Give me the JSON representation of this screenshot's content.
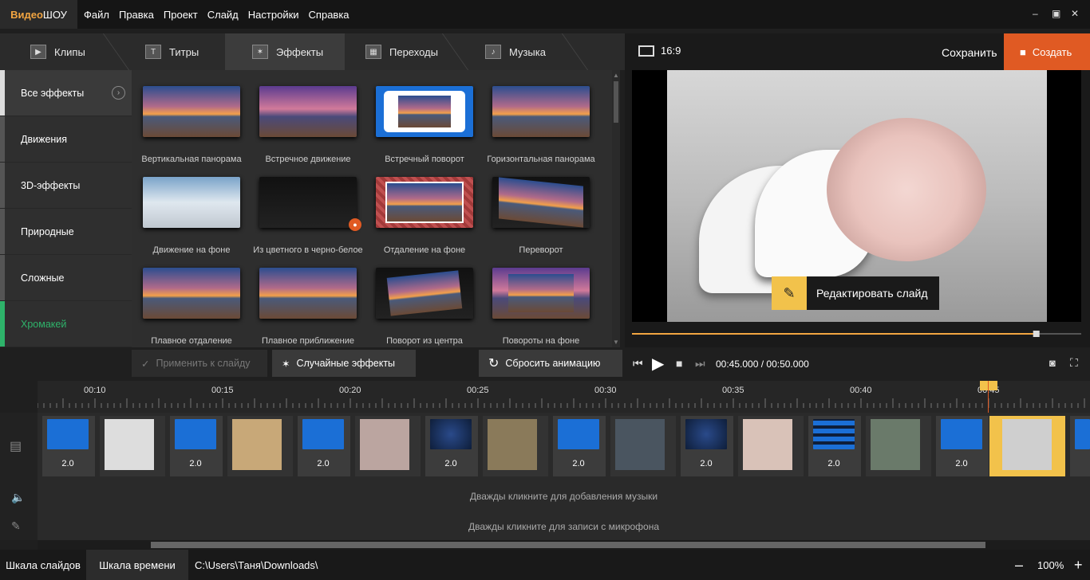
{
  "app": {
    "logo_part1": "Видео",
    "logo_part2": "ШОУ"
  },
  "menu": [
    "Файл",
    "Правка",
    "Проект",
    "Слайд",
    "Настройки",
    "Справка"
  ],
  "window_controls": {
    "minimize": "–",
    "restore": "▣",
    "close": "✕"
  },
  "tabs": [
    {
      "label": "Клипы",
      "icon": "play-icon"
    },
    {
      "label": "Титры",
      "icon": "text-icon"
    },
    {
      "label": "Эффекты",
      "icon": "magic-wand-icon",
      "active": true
    },
    {
      "label": "Переходы",
      "icon": "clapper-icon"
    },
    {
      "label": "Музыка",
      "icon": "music-note-icon"
    }
  ],
  "categories": [
    {
      "label": "Все эффекты",
      "active": true
    },
    {
      "label": "Движения"
    },
    {
      "label": "3D-эффекты"
    },
    {
      "label": "Природные"
    },
    {
      "label": "Сложные"
    },
    {
      "label": "Хромакей",
      "accent": "#2eb36a"
    }
  ],
  "effects": [
    "Вертикальная панорама",
    "Встречное движение",
    "Встречный поворот",
    "Горизонтальная панорама",
    "Движение на фоне",
    "Из цветного в черно-белое",
    "Отдаление на фоне",
    "Переворот",
    "Плавное отдаление",
    "Плавное приближение",
    "Поворот из центра",
    "Повороты на фоне"
  ],
  "buttons": {
    "apply": "Применить к слайду",
    "random": "Случайные эффекты",
    "reset": "Сбросить анимацию"
  },
  "preview": {
    "ratio": "16:9",
    "save": "Сохранить",
    "create": "Создать",
    "edit_slide": "Редактировать слайд",
    "progress": 0.9,
    "time_current": "00:45.000",
    "time_total": "00:50.000"
  },
  "ruler_labels": [
    "00:10",
    "00:15",
    "00:20",
    "00:25",
    "00:30",
    "00:35",
    "00:40",
    "00:45"
  ],
  "timeline": {
    "durations": [
      "2.0",
      "2.0",
      "2.0",
      "2.0",
      "2.0",
      "2.0",
      "2.0",
      "2.0"
    ],
    "music_hint": "Дважды кликните для добавления музыки",
    "mic_hint": "Дважды кликните для записи с микрофона"
  },
  "status": {
    "tab1": "Шкала слайдов",
    "tab2": "Шкала времени",
    "path": "C:\\Users\\Таня\\Downloads\\",
    "zoom": "100%",
    "minus": "–",
    "plus": "+"
  },
  "colors": {
    "accent": "#e05a23",
    "highlight": "#f2c24b",
    "green": "#2eb36a"
  }
}
